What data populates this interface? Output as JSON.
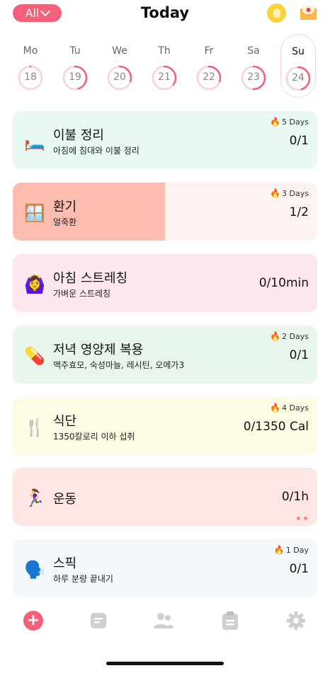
{
  "header": {
    "filter_label": "All",
    "title": "Today"
  },
  "week": [
    {
      "label": "Mo",
      "date": "18",
      "progress": 0.0
    },
    {
      "label": "Tu",
      "date": "19",
      "progress": 0.45
    },
    {
      "label": "We",
      "date": "20",
      "progress": 0.3
    },
    {
      "label": "Th",
      "date": "21",
      "progress": 0.35
    },
    {
      "label": "Fr",
      "date": "22",
      "progress": 0.3
    },
    {
      "label": "Sa",
      "date": "23",
      "progress": 0.5
    },
    {
      "label": "Su",
      "date": "24",
      "progress": 0.45
    }
  ],
  "habits": [
    {
      "icon": "bed-icon",
      "emoji": "🛏️",
      "title": "이불 정리",
      "subtitle": "아침에 침대와 이불 정리",
      "streak": "5 Days",
      "value": "0/1",
      "bg": "#e8f8f4",
      "fill": "#e8f8f4",
      "progress": 0.0
    },
    {
      "icon": "window-icon",
      "emoji": "🪟",
      "title": "환기",
      "subtitle": "얼죽환",
      "streak": "3 Days",
      "value": "1/2",
      "bg": "#fdf3f1",
      "fill": "#fdbcb0",
      "progress": 0.5
    },
    {
      "icon": "person-stretching-icon",
      "emoji": "🙆‍♀️",
      "title": "아침 스트레칭",
      "subtitle": "가벼운 스트레칭",
      "streak": "",
      "value": "0/10min",
      "bg": "#fde8ef",
      "fill": "#fde8ef",
      "progress": 0.0
    },
    {
      "icon": "pill-icon",
      "emoji": "💊",
      "title": "저녁 영양제 복용",
      "subtitle": "맥주효모, 숙성마늘, 레시틴, 오메가3",
      "streak": "2 Days",
      "value": "0/1",
      "bg": "#e8f6ec",
      "fill": "#e8f6ec",
      "progress": 0.0
    },
    {
      "icon": "fork-knife-icon",
      "emoji": "🍴",
      "title": "식단",
      "subtitle": "1350칼로리 이하 섭취",
      "streak": "4 Days",
      "value": "0/1350 Cal",
      "bg": "#fdfbe4",
      "fill": "#fdfbe4",
      "progress": 0.0
    },
    {
      "icon": "runner-icon",
      "emoji": "🏃‍♀️",
      "title": "운동",
      "subtitle": "",
      "streak": "",
      "value": "0/1h",
      "bg": "#fde6e4",
      "fill": "#fde6e4",
      "progress": 0.0
    },
    {
      "icon": "speaking-head-icon",
      "emoji": "🗣️",
      "title": "스픽",
      "subtitle": "하루 분량 끝내기",
      "streak": "1 Day",
      "value": "0/1",
      "bg": "#f3f8fa",
      "fill": "#f3f8fa",
      "progress": 0.0
    }
  ],
  "colors": {
    "accent": "#f2607a",
    "ring_track": "#f9d2d7",
    "ring_progress": "#f2607a",
    "inactive_icon": "#cfcfcf"
  },
  "tabs": [
    "add-icon",
    "notes-icon",
    "people-icon",
    "clipboard-icon",
    "gear-icon"
  ]
}
